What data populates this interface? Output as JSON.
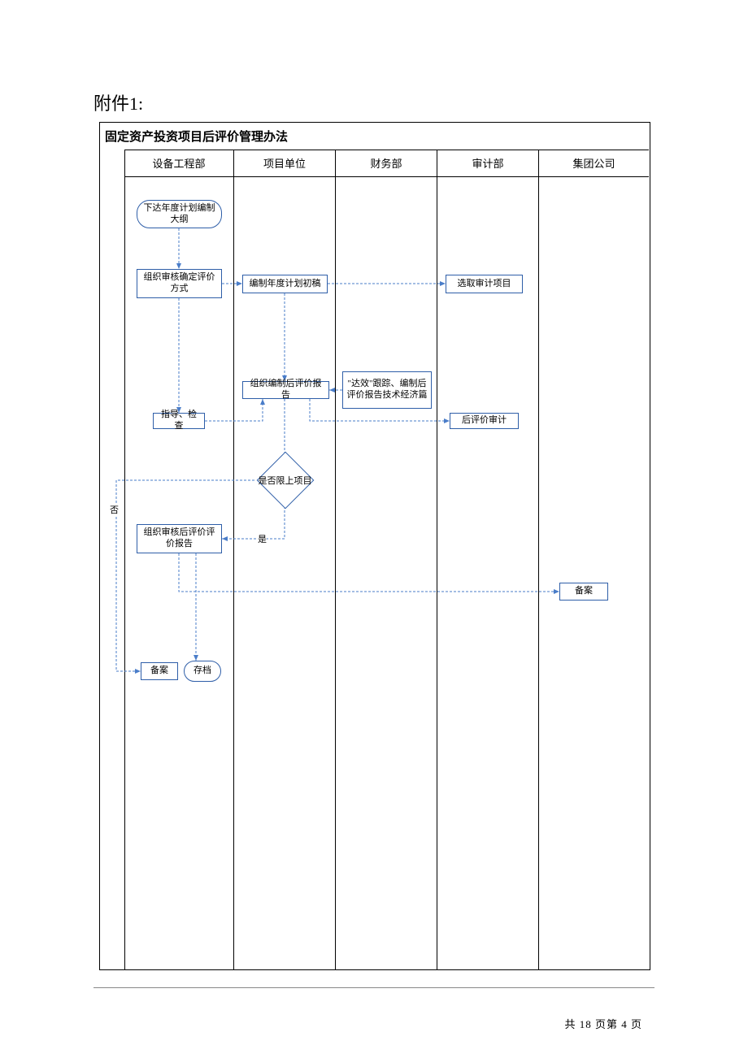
{
  "attachment_label": "附件1:",
  "diagram": {
    "title": "固定资产投资项目后评价管理办法",
    "lanes": [
      "设备工程部",
      "项目单位",
      "财务部",
      "审计部",
      "集团公司"
    ],
    "nodes": {
      "start": "下达年度计划编制大纲",
      "review_method": "组织审核确定评价方式",
      "draft_plan": "编制年度计划初稿",
      "select_audit": "选取审计项目",
      "guide_check": "指导、检查",
      "compile_report": "组织编制后评价报告",
      "finance_track": "\"达效\"跟踪、编制后评价报告技术经济篇",
      "post_audit": "后评价审计",
      "decision": "是否限上项目",
      "review_report": "组织审核后评价评价报告",
      "filing_group": "备案",
      "filing_local": "备案",
      "archive": "存档"
    },
    "branch_labels": {
      "no": "否",
      "yes": "是"
    }
  },
  "footer": {
    "page_text": "共 18 页第 4 页"
  },
  "chart_data": {
    "type": "swimlane-flowchart",
    "title": "固定资产投资项目后评价管理办法",
    "lanes": [
      "设备工程部",
      "项目单位",
      "财务部",
      "审计部",
      "集团公司"
    ],
    "nodes": [
      {
        "id": "start",
        "lane": "设备工程部",
        "shape": "terminator",
        "label": "下达年度计划编制大纲"
      },
      {
        "id": "review_method",
        "lane": "设备工程部",
        "shape": "process",
        "label": "组织审核确定评价方式"
      },
      {
        "id": "draft_plan",
        "lane": "项目单位",
        "shape": "process",
        "label": "编制年度计划初稿"
      },
      {
        "id": "select_audit",
        "lane": "审计部",
        "shape": "process",
        "label": "选取审计项目"
      },
      {
        "id": "guide_check",
        "lane": "设备工程部",
        "shape": "process",
        "label": "指导、检查"
      },
      {
        "id": "compile_report",
        "lane": "项目单位",
        "shape": "process",
        "label": "组织编制后评价报告"
      },
      {
        "id": "finance_track",
        "lane": "财务部",
        "shape": "process",
        "label": "\"达效\"跟踪、编制后评价报告技术经济篇"
      },
      {
        "id": "post_audit",
        "lane": "审计部",
        "shape": "process",
        "label": "后评价审计"
      },
      {
        "id": "decision",
        "lane": "项目单位",
        "shape": "decision",
        "label": "是否限上项目"
      },
      {
        "id": "review_report",
        "lane": "设备工程部",
        "shape": "process",
        "label": "组织审核后评价评价报告"
      },
      {
        "id": "filing_group",
        "lane": "集团公司",
        "shape": "process",
        "label": "备案"
      },
      {
        "id": "filing_local",
        "lane": "设备工程部",
        "shape": "process",
        "label": "备案"
      },
      {
        "id": "archive",
        "lane": "设备工程部",
        "shape": "terminator",
        "label": "存档"
      }
    ],
    "edges": [
      {
        "from": "start",
        "to": "review_method"
      },
      {
        "from": "review_method",
        "to": "draft_plan"
      },
      {
        "from": "draft_plan",
        "to": "select_audit"
      },
      {
        "from": "draft_plan",
        "to": "compile_report"
      },
      {
        "from": "review_method",
        "to": "guide_check"
      },
      {
        "from": "finance_track",
        "to": "compile_report"
      },
      {
        "from": "guide_check",
        "to": "compile_report"
      },
      {
        "from": "compile_report",
        "to": "post_audit"
      },
      {
        "from": "compile_report",
        "to": "decision"
      },
      {
        "from": "decision",
        "to": "review_report",
        "label": "是"
      },
      {
        "from": "decision",
        "to": "filing_local",
        "label": "否"
      },
      {
        "from": "review_report",
        "to": "filing_group"
      },
      {
        "from": "review_report",
        "to": "archive"
      },
      {
        "from": "decision_no_path",
        "to": "filing_local"
      }
    ]
  }
}
